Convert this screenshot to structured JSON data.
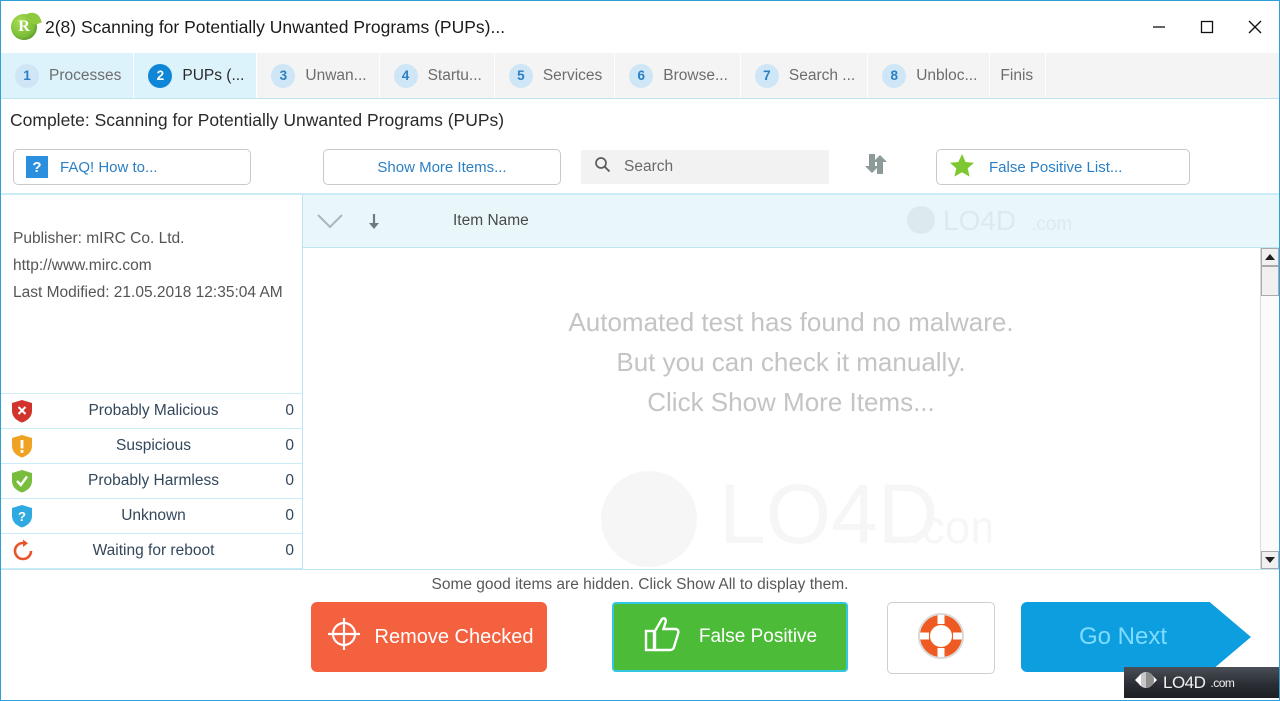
{
  "window": {
    "title": "2(8) Scanning for Potentially Unwanted Programs (PUPs)...",
    "app_icon": "roguekiller-leaf-icon",
    "minimize_label": "minimize-icon",
    "maximize_label": "maximize-icon",
    "close_label": "close-icon",
    "accent_color": "#0f86d6"
  },
  "tabs": [
    {
      "num": "1",
      "label": "Processes"
    },
    {
      "num": "2",
      "label": "PUPs (..."
    },
    {
      "num": "3",
      "label": "Unwan..."
    },
    {
      "num": "4",
      "label": "Startu..."
    },
    {
      "num": "5",
      "label": "Services"
    },
    {
      "num": "6",
      "label": "Browse..."
    },
    {
      "num": "7",
      "label": "Search ..."
    },
    {
      "num": "8",
      "label": "Unbloc..."
    }
  ],
  "tab_finish_label": "Finis",
  "status": {
    "text": "Complete: Scanning for Potentially Unwanted Programs (PUPs)"
  },
  "toolbar": {
    "faq_label": "FAQ! How to...",
    "faq_icon": "question-mark-icon",
    "show_more_label": "Show More Items...",
    "search_placeholder": "Search",
    "search_value": "",
    "search_icon": "search-icon",
    "refresh_icon": "refresh-icon",
    "false_positive_list_label": "False Positive List...",
    "star_icon": "star-icon"
  },
  "sidebar": {
    "publisher": "Publisher: mIRC Co. Ltd.",
    "url": "http://www.mirc.com",
    "last_modified": "Last Modified: 21.05.2018 12:35:04 AM",
    "counters": [
      {
        "icon": "shield-malicious-icon",
        "label": "Probably Malicious",
        "count": "0",
        "color": "#d0342c"
      },
      {
        "icon": "shield-suspicious-icon",
        "label": "Suspicious",
        "count": "0",
        "color": "#f0a323"
      },
      {
        "icon": "shield-harmless-icon",
        "label": "Probably Harmless",
        "count": "0",
        "color": "#79bd3f"
      },
      {
        "icon": "shield-unknown-icon",
        "label": "Unknown",
        "count": "0",
        "color": "#2eaae0"
      },
      {
        "icon": "reboot-icon",
        "label": "Waiting for reboot",
        "count": "0",
        "color": "#e8552d"
      }
    ]
  },
  "list": {
    "collapse_icon": "chevron-down-icon",
    "sort_icon": "arrow-down-icon",
    "column_header": "Item Name",
    "empty_line1": "Automated test has found no malware.",
    "empty_line2": "But you can check it manually.",
    "empty_line3": "Click Show More Items...",
    "watermark": "LO4D.com"
  },
  "footer": {
    "hint": "Some good items are hidden. Click Show All to display them.",
    "remove_checked_label": "Remove Checked",
    "remove_checked_icon": "crosshair-icon",
    "false_positive_label": "False Positive",
    "false_positive_icon": "thumbs-up-icon",
    "help_icon": "lifebuoy-icon",
    "go_next_label": "Go Next",
    "watermark": "LO4D",
    "watermark_suffix": ".com"
  }
}
